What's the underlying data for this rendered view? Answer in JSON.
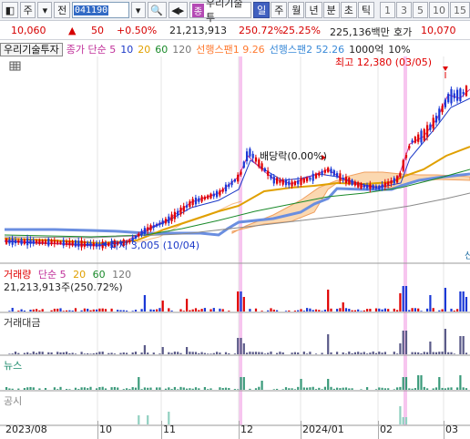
{
  "toolbar": {
    "market": "주",
    "period_btn": "전",
    "code": "041190",
    "name_badge": "종",
    "name": "우리기술투",
    "periods": [
      "일",
      "주",
      "월",
      "년",
      "분",
      "초",
      "틱"
    ],
    "active_period": "일",
    "intervals": [
      "1",
      "3",
      "5",
      "10",
      "15"
    ]
  },
  "quote": {
    "price": "10,060",
    "arrow": "▲",
    "change": "50",
    "rate": "+0.50%",
    "volume": "21,213,913",
    "vol_ratio": "250.72%",
    "turnover": "25.25%",
    "amount": "225,136백만",
    "ask_label": "호가",
    "ask": "10,070"
  },
  "legend": {
    "name": "우리기술투자",
    "close_ma": "종가 단순 5",
    "ma10": "10",
    "ma20": "20",
    "ma60": "60",
    "ma120": "120",
    "span1": "선행스팬1 9.26",
    "span2": "선행스팬2 52.26",
    "unit": "1000억",
    "pct": "10%"
  },
  "annotations": {
    "high": "최고 12,380 (03/05)",
    "low": "최저 3,005 (10/04)",
    "dividend": "배당락(0.00%)",
    "side_label": "신"
  },
  "volume_panel": {
    "title": "거래량",
    "ma_label": "단순 5",
    "ma20": "20",
    "ma60": "60",
    "ma120": "120",
    "value": "21,213,913주(250.72%)"
  },
  "panels": {
    "amount": "거래대금",
    "news": "뉴스",
    "disclosure": "공시"
  },
  "xaxis": [
    "2023/08",
    "10",
    "11",
    "12",
    "2024/01",
    "02",
    "03"
  ],
  "colors": {
    "up": "#e00000",
    "down": "#1a38d6",
    "ma5": "#d0349a",
    "ma10": "#1d3ac8",
    "ma20": "#e0a000",
    "ma60": "#1a8a2a",
    "ma120": "#8a8a8a",
    "cloud": "#f5a050",
    "highlight": "#f8c8f0"
  },
  "chart_data": {
    "type": "candlestick",
    "title": "",
    "x_ticks": [
      "2023/08",
      "10",
      "11",
      "12",
      "2024/01",
      "02",
      "03"
    ],
    "high": {
      "value": 12380,
      "date": "03/05"
    },
    "low": {
      "value": 3005,
      "date": "10/04"
    },
    "last_close": 10060,
    "last_volume": 21213913
  }
}
